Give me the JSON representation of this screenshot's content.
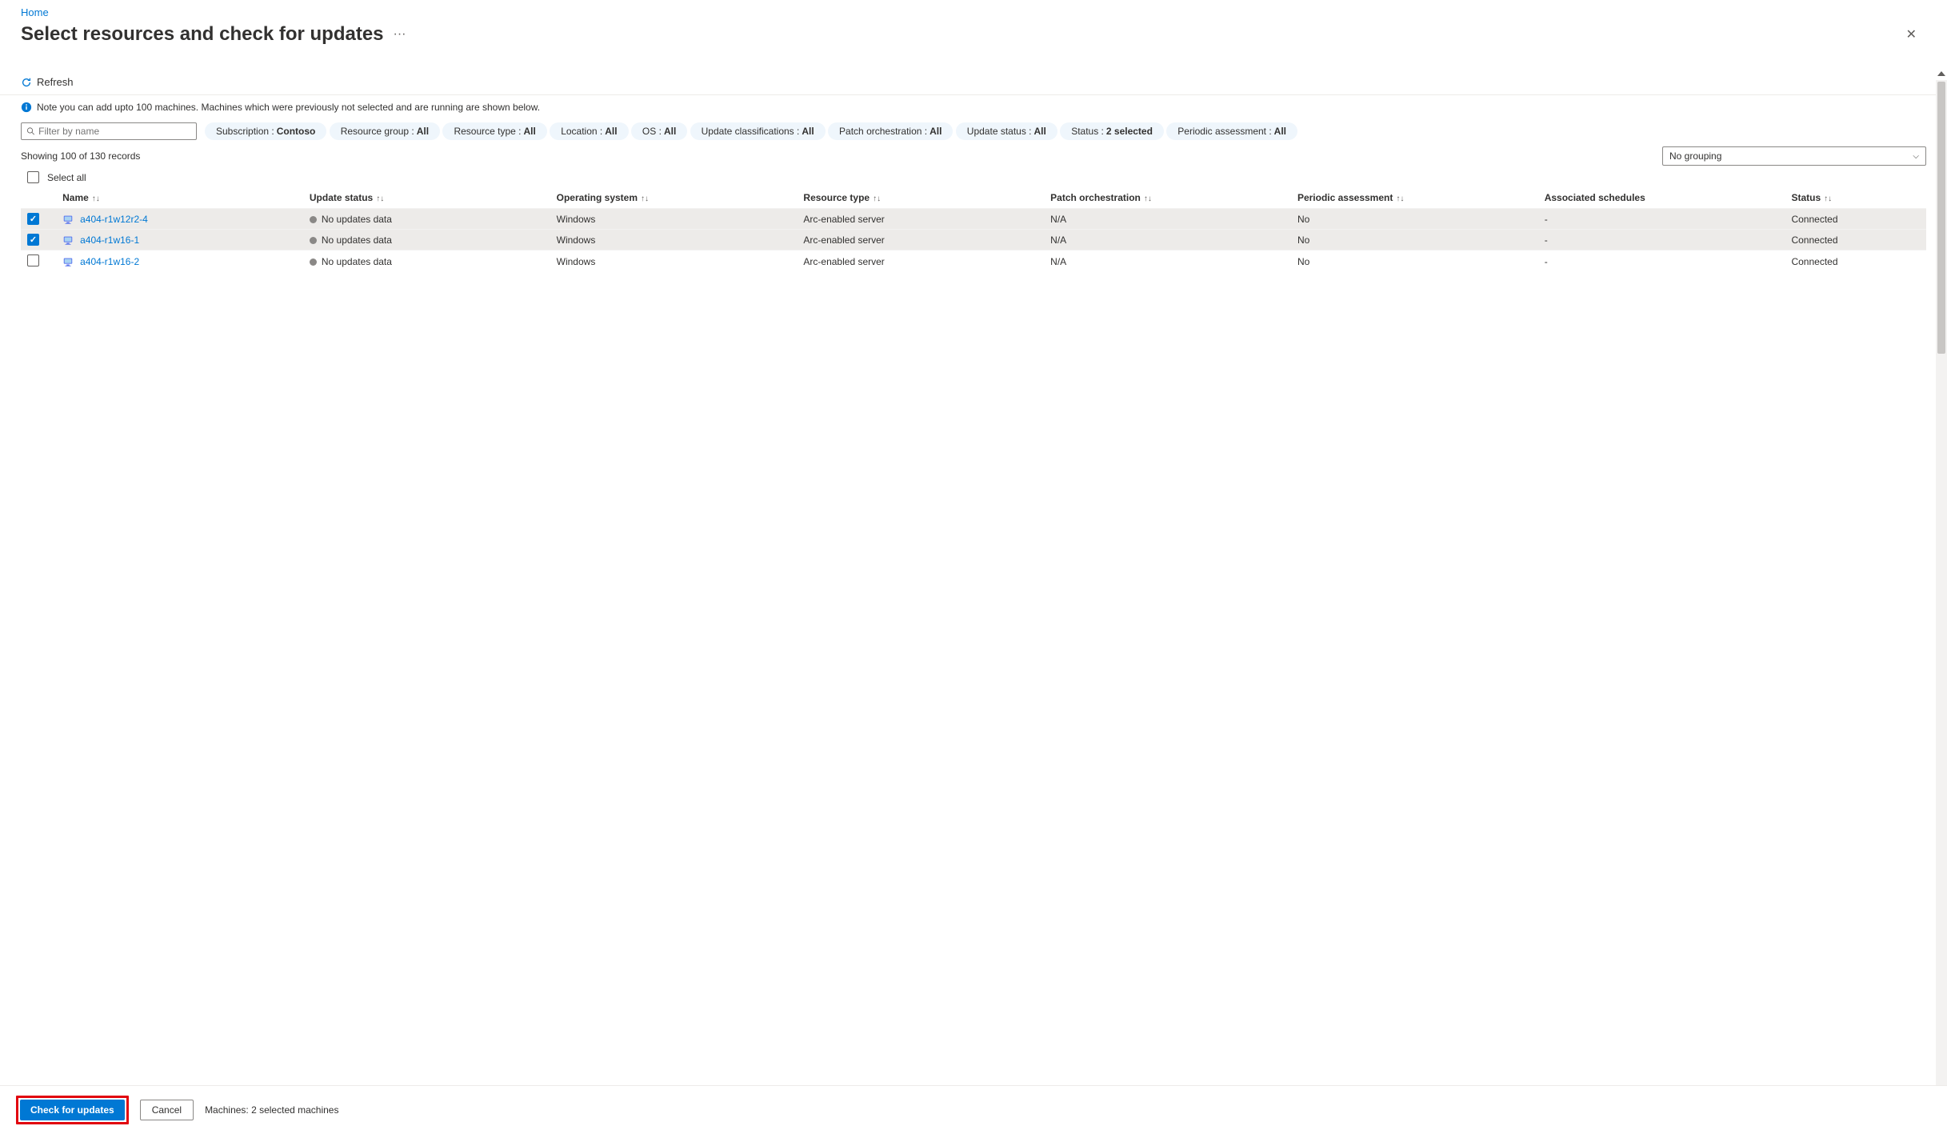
{
  "breadcrumb": {
    "home": "Home"
  },
  "header": {
    "title": "Select resources and check for updates"
  },
  "toolbar": {
    "refresh": "Refresh"
  },
  "infoBar": {
    "text": "Note you can add upto 100 machines. Machines which were previously not selected and are running are shown below."
  },
  "filters": {
    "placeholder": "Filter by name",
    "items": [
      {
        "label": "Subscription : ",
        "value": "Contoso"
      },
      {
        "label": "Resource group : ",
        "value": "All"
      },
      {
        "label": "Resource type : ",
        "value": "All"
      },
      {
        "label": "Location : ",
        "value": "All"
      },
      {
        "label": "OS : ",
        "value": "All"
      },
      {
        "label": "Update classifications : ",
        "value": "All"
      },
      {
        "label": "Patch orchestration : ",
        "value": "All"
      },
      {
        "label": "Update status : ",
        "value": "All"
      },
      {
        "label": "Status : ",
        "value": "2 selected"
      },
      {
        "label": "Periodic assessment : ",
        "value": "All"
      }
    ]
  },
  "summary": {
    "records": "Showing 100 of 130 records",
    "grouping": "No grouping"
  },
  "table": {
    "selectAll": "Select all",
    "headers": {
      "name": "Name",
      "updateStatus": "Update status",
      "os": "Operating system",
      "resourceType": "Resource type",
      "patch": "Patch orchestration",
      "periodic": "Periodic assessment",
      "assoc": "Associated schedules",
      "status": "Status"
    },
    "rows": [
      {
        "selected": true,
        "name": "a404-r1w12r2-4",
        "updateStatus": "No updates data",
        "os": "Windows",
        "resourceType": "Arc-enabled server",
        "patch": "N/A",
        "periodic": "No",
        "assoc": "-",
        "status": "Connected"
      },
      {
        "selected": true,
        "name": "a404-r1w16-1",
        "updateStatus": "No updates data",
        "os": "Windows",
        "resourceType": "Arc-enabled server",
        "patch": "N/A",
        "periodic": "No",
        "assoc": "-",
        "status": "Connected"
      },
      {
        "selected": false,
        "name": "a404-r1w16-2",
        "updateStatus": "No updates data",
        "os": "Windows",
        "resourceType": "Arc-enabled server",
        "patch": "N/A",
        "periodic": "No",
        "assoc": "-",
        "status": "Connected"
      }
    ]
  },
  "footer": {
    "check": "Check for updates",
    "cancel": "Cancel",
    "selected": "Machines: 2 selected machines"
  }
}
